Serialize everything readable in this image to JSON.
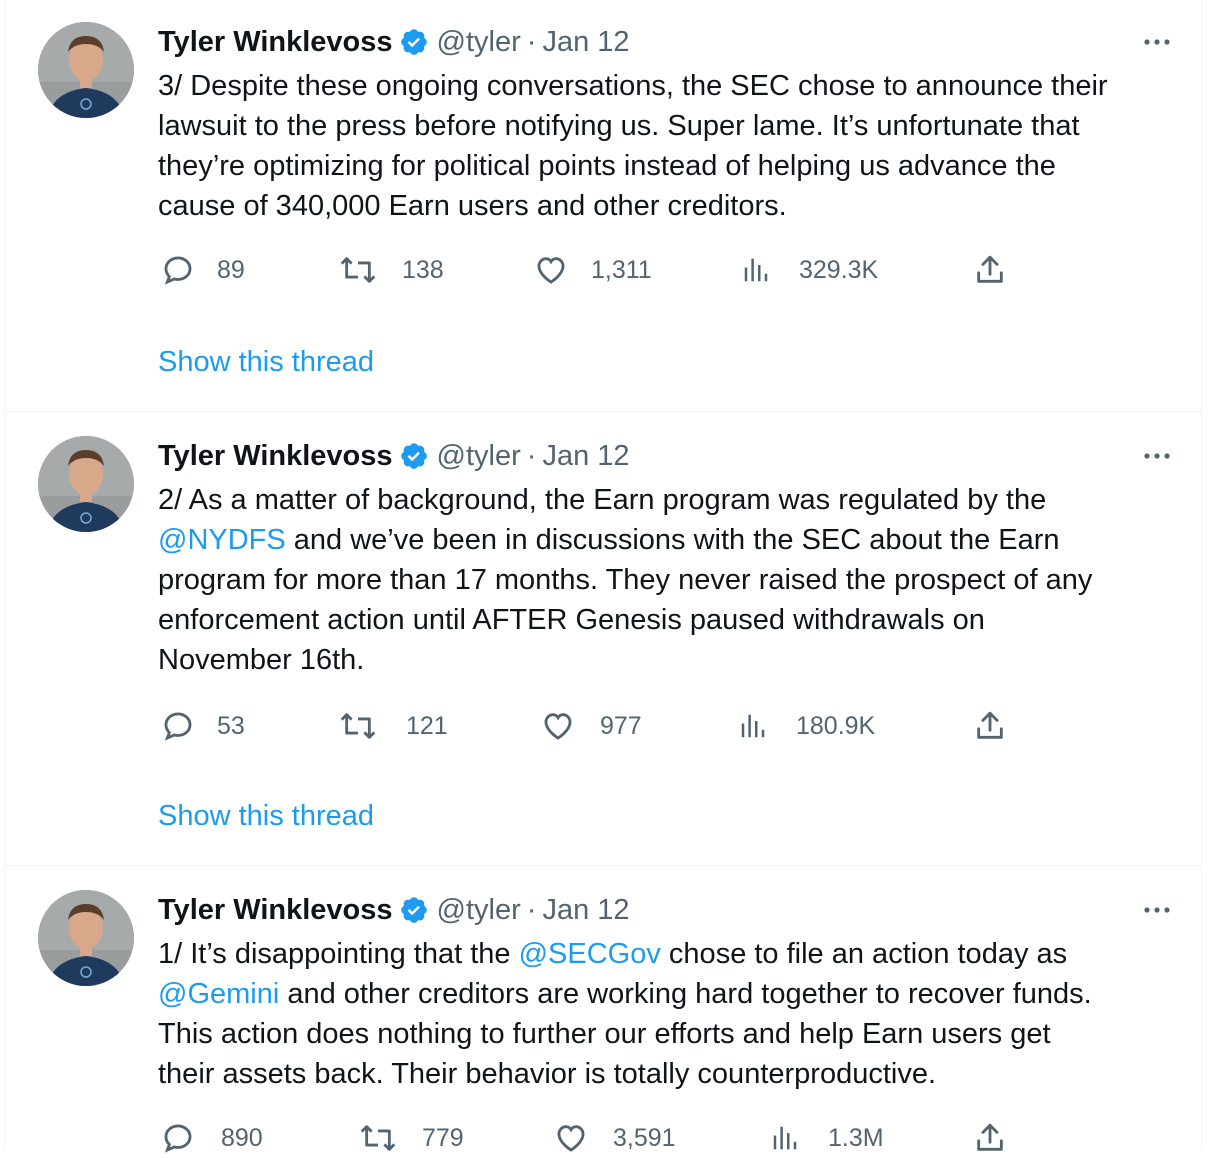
{
  "colors": {
    "accent": "#1d9bf0",
    "text": "#0f1419",
    "secondary": "#536471",
    "divider": "#eff3f4"
  },
  "tweets": [
    {
      "author": "Tyler Winklevoss",
      "handle": "@tyler",
      "separator": "·",
      "date": "Jan 12",
      "lines": [
        [
          {
            "t": "3/ Despite these ongoing conversations, the SEC chose to announce their"
          }
        ],
        [
          {
            "t": "lawsuit to the press before notifying us. Super lame. It’s unfortunate that"
          }
        ],
        [
          {
            "t": "they’re optimizing for political points instead of helping us advance the"
          }
        ],
        [
          {
            "t": "cause of 340,000 Earn users and other creditors."
          }
        ]
      ],
      "replies": "89",
      "retweets": "138",
      "likes": "1,311",
      "views": "329.3K",
      "show_thread": "Show this thread"
    },
    {
      "author": "Tyler Winklevoss",
      "handle": "@tyler",
      "separator": "·",
      "date": "Jan 12",
      "lines": [
        [
          {
            "t": "2/ As a matter of background, the Earn program was regulated by the"
          }
        ],
        [
          {
            "t": "@NYDFS",
            "m": true
          },
          {
            "t": " and we’ve been in discussions with the SEC about the Earn"
          }
        ],
        [
          {
            "t": "program for more than 17 months. They never raised the prospect of any"
          }
        ],
        [
          {
            "t": "enforcement action until AFTER Genesis paused withdrawals on"
          }
        ],
        [
          {
            "t": "November 16th."
          }
        ]
      ],
      "replies": "53",
      "retweets": "121",
      "likes": "977",
      "views": "180.9K",
      "show_thread": "Show this thread"
    },
    {
      "author": "Tyler Winklevoss",
      "handle": "@tyler",
      "separator": "·",
      "date": "Jan 12",
      "lines": [
        [
          {
            "t": "1/ It’s disappointing that the "
          },
          {
            "t": "@SECGov",
            "m": true
          },
          {
            "t": " chose to file an action today as"
          }
        ],
        [
          {
            "t": "@Gemini",
            "m": true
          },
          {
            "t": " and other creditors are working hard together to recover funds."
          }
        ],
        [
          {
            "t": "This action does nothing to further our efforts and help Earn users get"
          }
        ],
        [
          {
            "t": "their assets back. Their behavior is totally counterproductive."
          }
        ]
      ],
      "replies": "890",
      "retweets": "779",
      "likes": "3,591",
      "views": "1.3M"
    }
  ]
}
